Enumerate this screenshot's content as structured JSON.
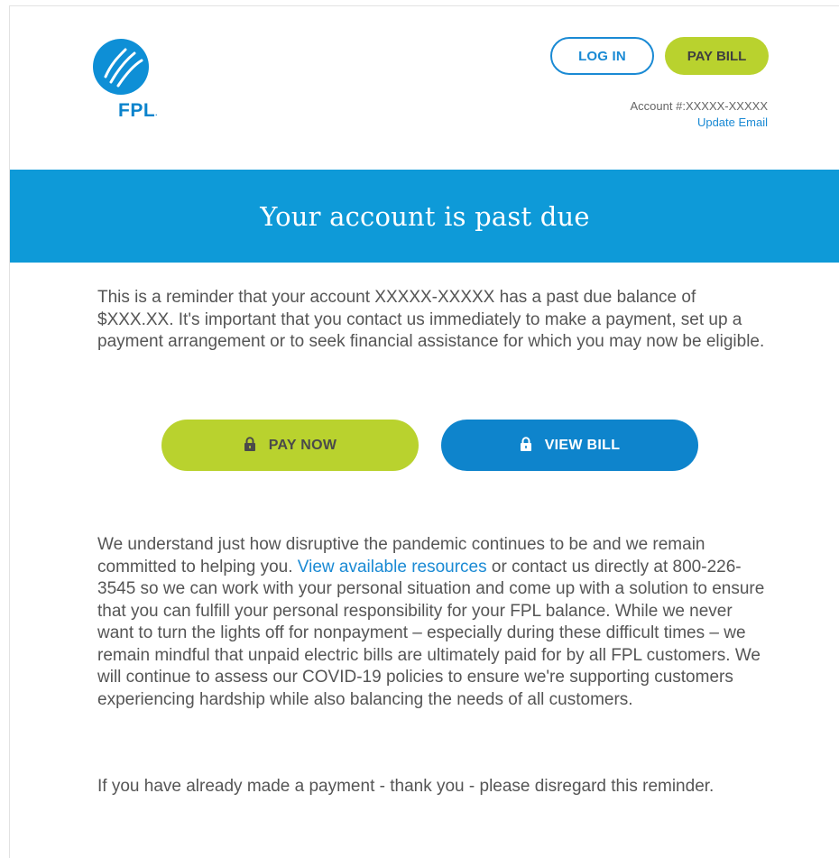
{
  "header": {
    "logo_text": "FPL",
    "login_label": "LOG IN",
    "pay_bill_label": "PAY BILL",
    "account_label": "Account #:",
    "account_number": "XXXXX-XXXXX",
    "update_email_label": "Update Email"
  },
  "banner": {
    "title": "Your account is past due"
  },
  "message": {
    "reminder": "This is a reminder that your account XXXXX-XXXXX has a past due balance of $XXX.XX. It's important that you contact us immediately to make a payment, set up a payment arrangement or to seek financial assistance for which you may now be eligible.",
    "pandemic_before_link": "We understand just how disruptive the pandemic continues to be and we remain committed to helping you. ",
    "resources_link": "View available resources",
    "pandemic_after_link": " or contact us directly at 800-226-3545 so we can work with your personal situation and come up with a solution to ensure that you can fulfill your personal responsibility for your FPL balance. While we never want to turn the lights off for nonpayment – especially during these difficult times – we remain mindful that unpaid electric bills are ultimately paid for by all FPL customers. We will continue to assess our COVID-19 policies to ensure we're supporting customers experiencing hardship while also balancing the needs of all customers.",
    "disregard": "If you have already made a payment - thank you - please disregard this reminder."
  },
  "actions": {
    "pay_now_label": "PAY NOW",
    "view_bill_label": "VIEW BILL"
  },
  "colors": {
    "brand_blue": "#0e9ad8",
    "brand_green": "#b9d22e",
    "link_blue": "#1a8ad4"
  },
  "icons": {
    "logo": "fpl-logo-icon",
    "lock": "lock-icon"
  }
}
